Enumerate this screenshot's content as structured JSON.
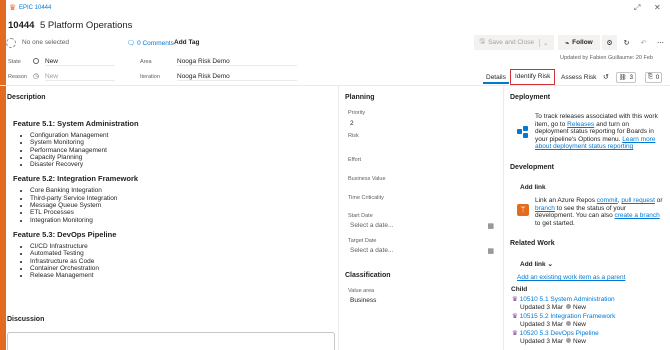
{
  "header": {
    "breadcrumb": "EPIC 10444",
    "id": "10444",
    "title": "5 Platform Operations"
  },
  "toolbar": {
    "assignee": "No one selected",
    "comments": "0 Comments",
    "add_tag": "Add Tag",
    "save_close": "Save and Close",
    "follow": "Follow"
  },
  "fields": {
    "state_label": "State",
    "state_value": "New",
    "area_label": "Area",
    "area_value": "Nooga Risk Demo",
    "reason_label": "Reason",
    "reason_value": "New",
    "iteration_label": "Iteration",
    "iteration_value": "Nooga Risk Demo"
  },
  "updated": "Updated by Fabien Guillaume: 20 Feb",
  "tabs": {
    "details": "Details",
    "identify_risk": "Identify Risk",
    "assess_risk": "Assess Risk",
    "links_count": "3",
    "attach_count": "0"
  },
  "description": {
    "heading": "Description",
    "f1_title": "Feature 5.1: System Administration",
    "f1_items": [
      "Configuration Management",
      "System Monitoring",
      "Performance Management",
      "Capacity Planning",
      "Disaster Recovery"
    ],
    "f2_title": "Feature 5.2: Integration Framework",
    "f2_items": [
      "Core Banking Integration",
      "Third-party Service Integration",
      "Message Queue System",
      "ETL Processes",
      "Integration Monitoring"
    ],
    "f3_title": "Feature 5.3: DevOps Pipeline",
    "f3_items": [
      "CI/CD Infrastructure",
      "Automated Testing",
      "Infrastructure as Code",
      "Container Orchestration",
      "Release Management"
    ]
  },
  "discussion": {
    "heading": "Discussion"
  },
  "planning": {
    "heading": "Planning",
    "priority_label": "Priority",
    "priority_value": "2",
    "risk_label": "Risk",
    "effort_label": "Effort",
    "business_value_label": "Business Value",
    "time_criticality_label": "Time Criticality",
    "start_date_label": "Start Date",
    "start_date_placeholder": "Select a date...",
    "target_date_label": "Target Date",
    "target_date_placeholder": "Select a date..."
  },
  "classification": {
    "heading": "Classification",
    "value_area_label": "Value area",
    "value_area_value": "Business"
  },
  "deployment": {
    "heading": "Deployment",
    "text1": "To track releases associated with this work item, go to ",
    "releases_link": "Releases",
    "text2": " and turn on deployment status reporting for Boards in your pipeline's Options menu. ",
    "learn_more": "Learn more about deployment status reporting"
  },
  "development": {
    "heading": "Development",
    "add_link": "Add link",
    "text1": "Link an Azure Repos ",
    "commit": "commit",
    "sep1": ", ",
    "pull_request": "pull request",
    "text2": " or ",
    "branch": "branch",
    "text3": " to see the status of your development. You can also ",
    "create_branch": "create a branch",
    "text4": " to get started."
  },
  "related_work": {
    "heading": "Related Work",
    "add_link": "Add link",
    "add_existing": "Add an existing work item as a parent",
    "child_label": "Child",
    "items": [
      {
        "id": "10510",
        "title": "5.1 System Administration",
        "updated": "Updated 3 Mar",
        "state": "New"
      },
      {
        "id": "10515",
        "title": "5.2 Integration Framework",
        "updated": "Updated 3 Mar",
        "state": "New"
      },
      {
        "id": "10520",
        "title": "5.3 DevOps Pipeline",
        "updated": "Updated 3 Mar",
        "state": "New"
      }
    ]
  },
  "colors": {
    "accent": "#e36b20",
    "link": "#0078d4",
    "highlight": "#d13438"
  }
}
